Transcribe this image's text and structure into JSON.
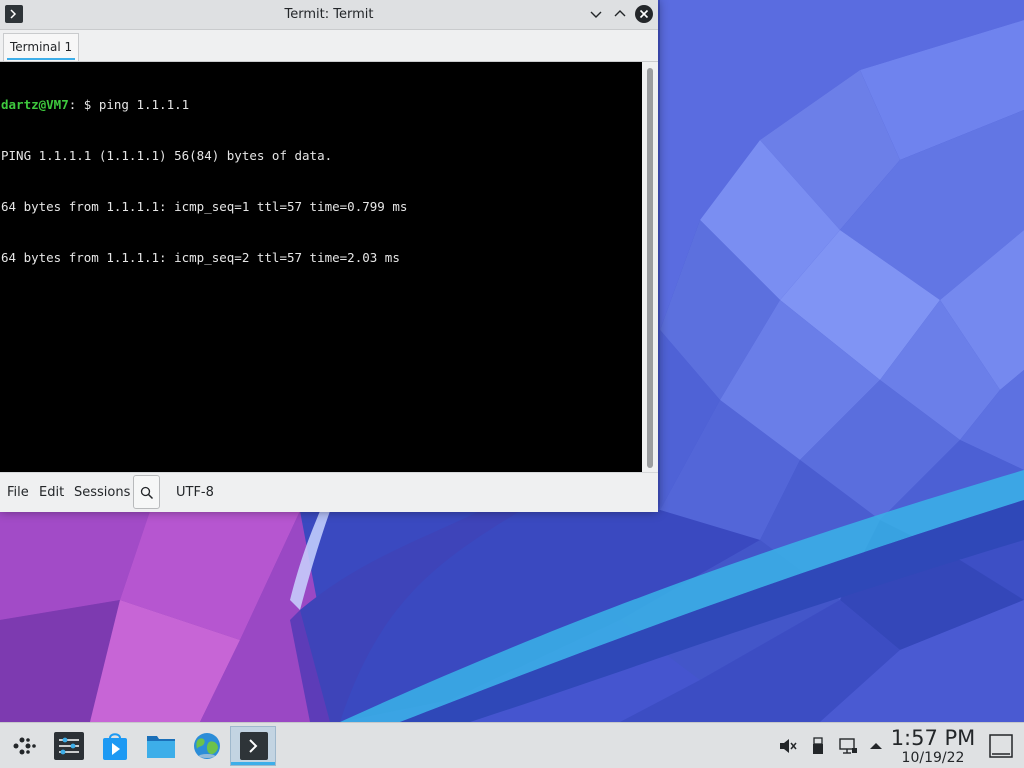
{
  "window": {
    "title": "Termit: Termit",
    "app_icon": "terminal-prompt-icon",
    "controls": [
      "minimize-icon",
      "maximize-icon",
      "close-icon"
    ]
  },
  "tabs": [
    {
      "label": "Terminal 1",
      "active": true
    }
  ],
  "terminal": {
    "user_host": "dartz@VM7",
    "prompt_rest": ": $ ping 1.1.1.1",
    "output": [
      "PING 1.1.1.1 (1.1.1.1) 56(84) bytes of data.",
      "64 bytes from 1.1.1.1: icmp_seq=1 ttl=57 time=0.799 ms",
      "64 bytes from 1.1.1.1: icmp_seq=2 ttl=57 time=2.03 ms"
    ]
  },
  "bottombar": {
    "menus": [
      "File",
      "Edit",
      "Sessions"
    ],
    "search_icon": "search-icon",
    "encoding": "UTF-8"
  },
  "taskbar": {
    "apps": [
      "launcher-icon",
      "system-settings-icon",
      "discover-icon",
      "file-manager-icon",
      "web-browser-icon",
      "termit-icon"
    ],
    "tray": [
      "volume-muted-icon",
      "usb-icon",
      "network-icon",
      "expand-arrow-icon"
    ],
    "clock": {
      "time": "1:57 PM",
      "date": "10/19/22"
    },
    "show_desktop": "show-desktop-icon"
  },
  "colors": {
    "accent": "#3daee9",
    "terminal_bg": "#000000",
    "terminal_fg": "#e6e6e6",
    "prompt_user": "#3ec93e",
    "titlebar": "#dee0e2",
    "panel": "#dfe1e3"
  }
}
